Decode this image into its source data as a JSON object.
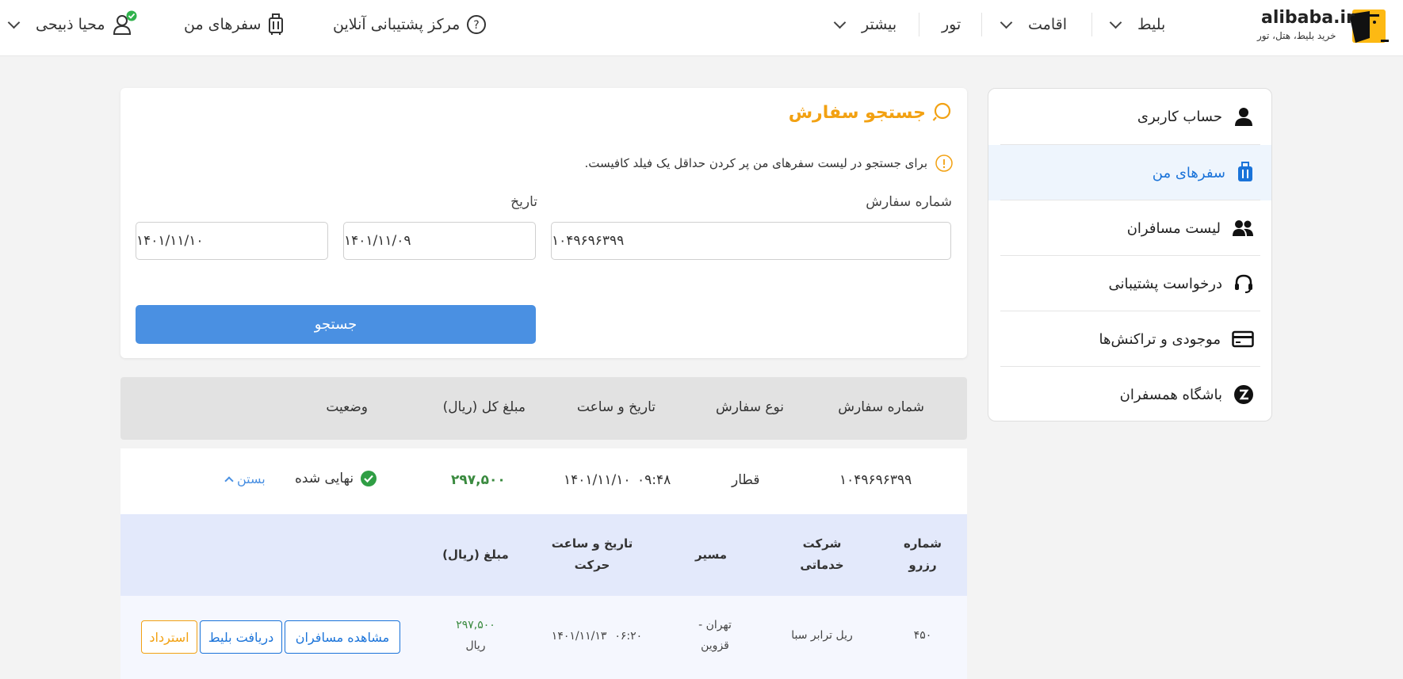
{
  "header": {
    "logo_text": "alibaba.ir",
    "logo_subtitle": "خرید بلیط، هتل، تور",
    "nav": {
      "ticket": "بلیط",
      "stay": "اقامت",
      "tour": "تور",
      "more": "بیشتر"
    },
    "support": "مرکز پشتیبانی آنلاین",
    "my_trips": "سفرهای من",
    "user_name": "محیا ذبیحی"
  },
  "sidebar": {
    "items": [
      {
        "label": "حساب کاربری",
        "icon": "user-icon"
      },
      {
        "label": "سفرهای من",
        "icon": "suitcase-icon"
      },
      {
        "label": "لیست مسافران",
        "icon": "users-icon"
      },
      {
        "label": "درخواست پشتیبانی",
        "icon": "headset-icon"
      },
      {
        "label": "موجودی و تراکنش‌ها",
        "icon": "card-icon"
      },
      {
        "label": "باشگاه همسفران",
        "icon": "club-icon"
      }
    ]
  },
  "search": {
    "title": "جستجو سفارش",
    "info": "برای جستجو در لیست سفرهای من پر کردن حداقل یک فیلد کافیست.",
    "order_label": "شماره سفارش",
    "order_value": "۱۰۴۹۶۹۶۳۹۹",
    "date_label": "تاریخ",
    "date_from": "۱۴۰۱/۱۱/۰۹",
    "date_to": "۱۴۰۱/۱۱/۱۰",
    "button": "جستجو"
  },
  "table": {
    "headers": {
      "order_no": "شماره سفارش",
      "order_type": "نوع سفارش",
      "datetime": "تاریخ و ساعت",
      "total": "مبلغ کل (ریال)",
      "status": "وضعیت"
    },
    "row": {
      "order_no": "۱۰۴۹۶۹۶۳۹۹",
      "order_type": "قطار",
      "date": "۱۴۰۱/۱۱/۱۰",
      "time": "۰۹:۴۸",
      "total": "۲۹۷,۵۰۰",
      "status": "نهایی شده",
      "close": "بستن"
    },
    "sub_headers": {
      "reserve_l1": "شماره",
      "reserve_l2": "رزرو",
      "company_l1": "شرکت",
      "company_l2": "خدماتی",
      "route": "مسیر",
      "move_l1": "تاریخ و ساعت",
      "move_l2": "حرکت",
      "amount": "مبلغ (ریال)"
    },
    "sub_row": {
      "reserve": "۴۵۰",
      "company": "ریل ترابر سبا",
      "route_l1": "تهران -",
      "route_l2": "قزوین",
      "move_date": "۱۴۰۱/۱۱/۱۳",
      "move_time": "۰۶:۲۰",
      "amount": "۲۹۷,۵۰۰",
      "currency": "ریال",
      "btn_passengers": "مشاهده مسافران",
      "btn_ticket": "دریافت بلیط",
      "btn_refund": "استرداد"
    }
  },
  "colors": {
    "accent_orange": "#f2a112",
    "primary_blue": "#4a90e2",
    "active_blue": "#1a73d9",
    "success_green": "#2f9e44",
    "amount_green": "#3a8a3f"
  }
}
